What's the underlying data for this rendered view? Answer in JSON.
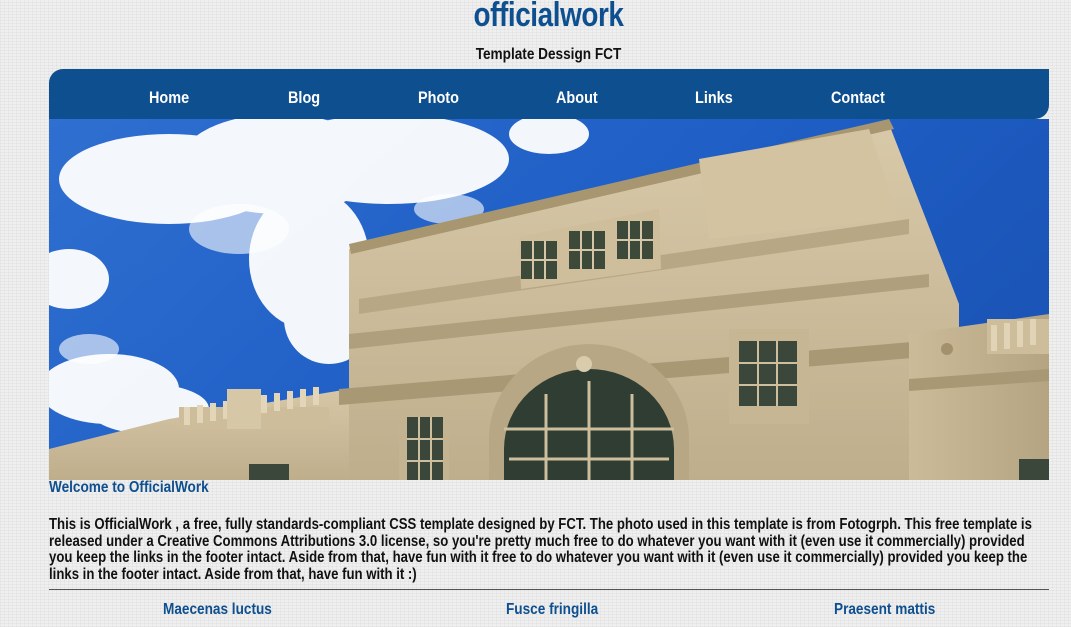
{
  "header": {
    "title": "officialwork",
    "subtitle": "Template Dessign FCT"
  },
  "nav": {
    "items": [
      {
        "label": "Home"
      },
      {
        "label": "Blog"
      },
      {
        "label": "Photo"
      },
      {
        "label": "About"
      },
      {
        "label": "Links"
      },
      {
        "label": "Contact"
      }
    ]
  },
  "hero": {
    "image_description_icon": "building-photo"
  },
  "content": {
    "heading": "Welcome to OfficialWork",
    "body": "This is OfficialWork , a free, fully standards-compliant CSS template designed by FCT. The photo used in this template is from Fotogrph. This free template is released under a Creative Commons Attributions 3.0 license, so you're pretty much free to do whatever you want with it (even use it commercially) provided you keep the links in the footer intact. Aside from that, have fun with it free to do whatever you want with it (even use it commercially) provided you keep the links in the footer intact. Aside from that, have fun with it :)"
  },
  "columns": [
    {
      "heading": "Maecenas luctus"
    },
    {
      "heading": "Fusce fringilla"
    },
    {
      "heading": "Praesent mattis"
    }
  ],
  "colors": {
    "brand_blue": "#0e4f8f",
    "background": "#efefef",
    "text": "#111111"
  }
}
